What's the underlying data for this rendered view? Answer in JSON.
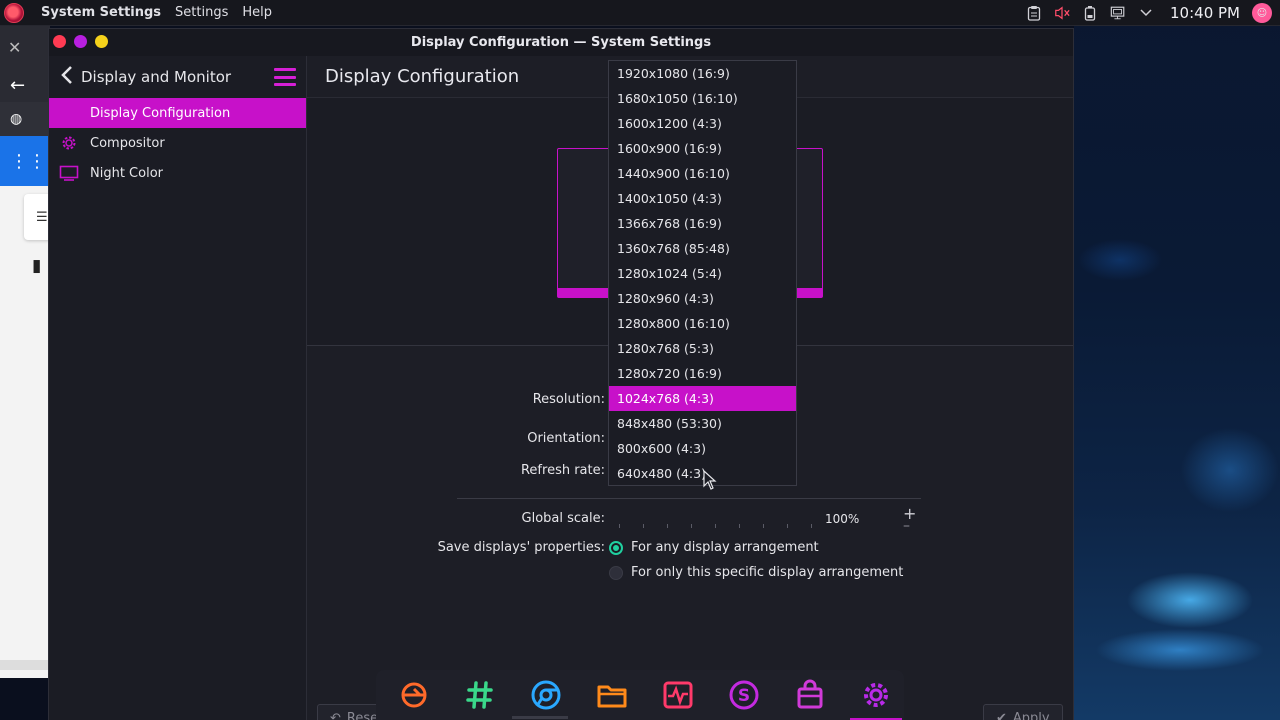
{
  "top_panel": {
    "app_name": "System Settings",
    "menus": [
      "Settings",
      "Help"
    ],
    "clock": "10:40 PM"
  },
  "window": {
    "title": "Display Configuration — System Settings"
  },
  "sidebar": {
    "back_label": "Display and Monitor",
    "items": [
      {
        "label": "Display Configuration",
        "icon": "display-icon",
        "active": true
      },
      {
        "label": "Compositor",
        "icon": "gear-icon",
        "active": false
      },
      {
        "label": "Night Color",
        "icon": "monitor-icon",
        "active": false
      }
    ]
  },
  "content": {
    "title": "Display Configuration",
    "form": {
      "resolution_label": "Resolution:",
      "orientation_label": "Orientation:",
      "refresh_label": "Refresh rate:",
      "scale_label": "Global scale:",
      "scale_value": "100%",
      "save_label": "Save displays' properties:",
      "save_options": [
        {
          "label": "For any display arrangement",
          "checked": true
        },
        {
          "label": "For only this specific display arrangement",
          "checked": false
        }
      ]
    },
    "buttons": {
      "reset": "Rese",
      "apply": "Apply"
    }
  },
  "resolution_dropdown": {
    "options": [
      "1920x1080 (16:9)",
      "1680x1050 (16:10)",
      "1600x1200 (4:3)",
      "1600x900 (16:9)",
      "1440x900 (16:10)",
      "1400x1050 (4:3)",
      "1366x768 (16:9)",
      "1360x768 (85:48)",
      "1280x1024 (5:4)",
      "1280x960 (4:3)",
      "1280x800 (16:10)",
      "1280x768 (5:3)",
      "1280x720 (16:9)",
      "1024x768 (4:3)",
      "848x480 (53:30)",
      "800x600 (4:3)",
      "640x480 (4:3)"
    ],
    "selected": "1024x768 (4:3)"
  },
  "colors": {
    "accent": "#c711c9",
    "radio_on": "#20d0a0"
  },
  "dock": {
    "apps": [
      "app-launcher-icon",
      "hashtag-icon",
      "chromium-icon",
      "folder-icon",
      "activity-monitor-icon",
      "s-app-icon",
      "store-icon",
      "settings-gear-icon"
    ],
    "active": "settings-gear-icon"
  }
}
